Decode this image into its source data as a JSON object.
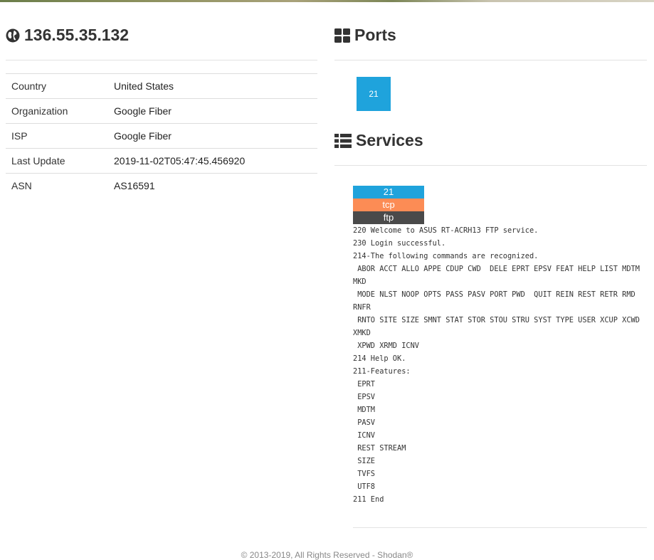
{
  "host": {
    "ip": "136.55.35.132",
    "icon": "globe-icon"
  },
  "info_rows": [
    {
      "label": "Country",
      "value": "United States"
    },
    {
      "label": "Organization",
      "value": "Google Fiber"
    },
    {
      "label": "ISP",
      "value": "Google Fiber"
    },
    {
      "label": "Last Update",
      "value": "2019-11-02T05:47:45.456920"
    },
    {
      "label": "ASN",
      "value": "AS16591"
    }
  ],
  "ports": {
    "title": "Ports",
    "icon": "grid-icon",
    "items": [
      "21"
    ]
  },
  "services": {
    "title": "Services",
    "icon": "list-icon",
    "items": [
      {
        "port": "21",
        "protocol": "tcp",
        "name": "ftp",
        "banner": "220 Welcome to ASUS RT-ACRH13 FTP service.\n230 Login successful.\n214-The following commands are recognized.\n ABOR ACCT ALLO APPE CDUP CWD  DELE EPRT EPSV FEAT HELP LIST MDTM MKD\n MODE NLST NOOP OPTS PASS PASV PORT PWD  QUIT REIN REST RETR RMD  RNFR\n RNTO SITE SIZE SMNT STAT STOR STOU STRU SYST TYPE USER XCUP XCWD XMKD\n XPWD XRMD ICNV\n214 Help OK.\n211-Features:\n EPRT\n EPSV\n MDTM\n PASV\n ICNV\n REST STREAM\n SIZE\n TVFS\n UTF8\n211 End"
      }
    ]
  },
  "colors": {
    "port_blue": "#1fa3dc",
    "protocol_orange": "#fc8c55",
    "service_dark": "#4a4a4a"
  },
  "footer": {
    "text": "© 2013-2019, All Rights Reserved - Shodan®"
  }
}
